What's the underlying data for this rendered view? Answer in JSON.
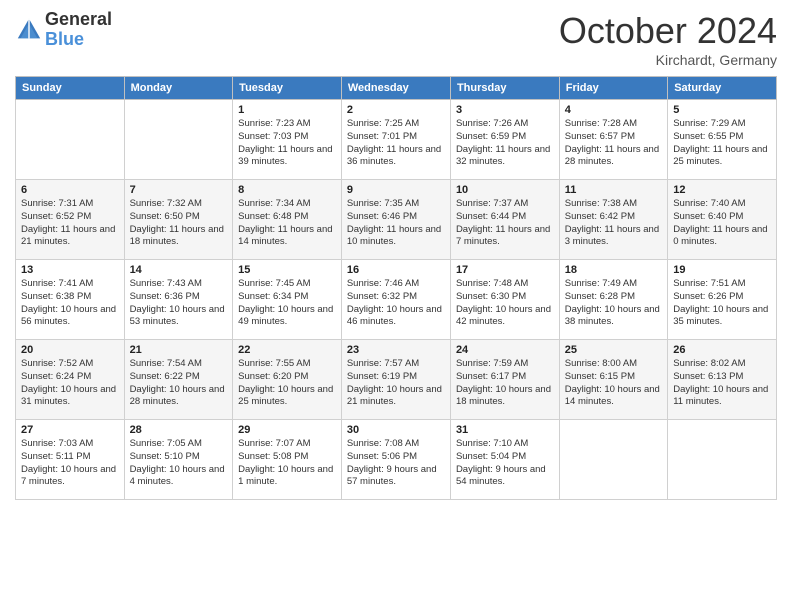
{
  "header": {
    "logo_general": "General",
    "logo_blue": "Blue",
    "month": "October 2024",
    "location": "Kirchardt, Germany"
  },
  "days_of_week": [
    "Sunday",
    "Monday",
    "Tuesday",
    "Wednesday",
    "Thursday",
    "Friday",
    "Saturday"
  ],
  "weeks": [
    [
      {
        "num": "",
        "sunrise": "",
        "sunset": "",
        "daylight": ""
      },
      {
        "num": "",
        "sunrise": "",
        "sunset": "",
        "daylight": ""
      },
      {
        "num": "1",
        "sunrise": "Sunrise: 7:23 AM",
        "sunset": "Sunset: 7:03 PM",
        "daylight": "Daylight: 11 hours and 39 minutes."
      },
      {
        "num": "2",
        "sunrise": "Sunrise: 7:25 AM",
        "sunset": "Sunset: 7:01 PM",
        "daylight": "Daylight: 11 hours and 36 minutes."
      },
      {
        "num": "3",
        "sunrise": "Sunrise: 7:26 AM",
        "sunset": "Sunset: 6:59 PM",
        "daylight": "Daylight: 11 hours and 32 minutes."
      },
      {
        "num": "4",
        "sunrise": "Sunrise: 7:28 AM",
        "sunset": "Sunset: 6:57 PM",
        "daylight": "Daylight: 11 hours and 28 minutes."
      },
      {
        "num": "5",
        "sunrise": "Sunrise: 7:29 AM",
        "sunset": "Sunset: 6:55 PM",
        "daylight": "Daylight: 11 hours and 25 minutes."
      }
    ],
    [
      {
        "num": "6",
        "sunrise": "Sunrise: 7:31 AM",
        "sunset": "Sunset: 6:52 PM",
        "daylight": "Daylight: 11 hours and 21 minutes."
      },
      {
        "num": "7",
        "sunrise": "Sunrise: 7:32 AM",
        "sunset": "Sunset: 6:50 PM",
        "daylight": "Daylight: 11 hours and 18 minutes."
      },
      {
        "num": "8",
        "sunrise": "Sunrise: 7:34 AM",
        "sunset": "Sunset: 6:48 PM",
        "daylight": "Daylight: 11 hours and 14 minutes."
      },
      {
        "num": "9",
        "sunrise": "Sunrise: 7:35 AM",
        "sunset": "Sunset: 6:46 PM",
        "daylight": "Daylight: 11 hours and 10 minutes."
      },
      {
        "num": "10",
        "sunrise": "Sunrise: 7:37 AM",
        "sunset": "Sunset: 6:44 PM",
        "daylight": "Daylight: 11 hours and 7 minutes."
      },
      {
        "num": "11",
        "sunrise": "Sunrise: 7:38 AM",
        "sunset": "Sunset: 6:42 PM",
        "daylight": "Daylight: 11 hours and 3 minutes."
      },
      {
        "num": "12",
        "sunrise": "Sunrise: 7:40 AM",
        "sunset": "Sunset: 6:40 PM",
        "daylight": "Daylight: 11 hours and 0 minutes."
      }
    ],
    [
      {
        "num": "13",
        "sunrise": "Sunrise: 7:41 AM",
        "sunset": "Sunset: 6:38 PM",
        "daylight": "Daylight: 10 hours and 56 minutes."
      },
      {
        "num": "14",
        "sunrise": "Sunrise: 7:43 AM",
        "sunset": "Sunset: 6:36 PM",
        "daylight": "Daylight: 10 hours and 53 minutes."
      },
      {
        "num": "15",
        "sunrise": "Sunrise: 7:45 AM",
        "sunset": "Sunset: 6:34 PM",
        "daylight": "Daylight: 10 hours and 49 minutes."
      },
      {
        "num": "16",
        "sunrise": "Sunrise: 7:46 AM",
        "sunset": "Sunset: 6:32 PM",
        "daylight": "Daylight: 10 hours and 46 minutes."
      },
      {
        "num": "17",
        "sunrise": "Sunrise: 7:48 AM",
        "sunset": "Sunset: 6:30 PM",
        "daylight": "Daylight: 10 hours and 42 minutes."
      },
      {
        "num": "18",
        "sunrise": "Sunrise: 7:49 AM",
        "sunset": "Sunset: 6:28 PM",
        "daylight": "Daylight: 10 hours and 38 minutes."
      },
      {
        "num": "19",
        "sunrise": "Sunrise: 7:51 AM",
        "sunset": "Sunset: 6:26 PM",
        "daylight": "Daylight: 10 hours and 35 minutes."
      }
    ],
    [
      {
        "num": "20",
        "sunrise": "Sunrise: 7:52 AM",
        "sunset": "Sunset: 6:24 PM",
        "daylight": "Daylight: 10 hours and 31 minutes."
      },
      {
        "num": "21",
        "sunrise": "Sunrise: 7:54 AM",
        "sunset": "Sunset: 6:22 PM",
        "daylight": "Daylight: 10 hours and 28 minutes."
      },
      {
        "num": "22",
        "sunrise": "Sunrise: 7:55 AM",
        "sunset": "Sunset: 6:20 PM",
        "daylight": "Daylight: 10 hours and 25 minutes."
      },
      {
        "num": "23",
        "sunrise": "Sunrise: 7:57 AM",
        "sunset": "Sunset: 6:19 PM",
        "daylight": "Daylight: 10 hours and 21 minutes."
      },
      {
        "num": "24",
        "sunrise": "Sunrise: 7:59 AM",
        "sunset": "Sunset: 6:17 PM",
        "daylight": "Daylight: 10 hours and 18 minutes."
      },
      {
        "num": "25",
        "sunrise": "Sunrise: 8:00 AM",
        "sunset": "Sunset: 6:15 PM",
        "daylight": "Daylight: 10 hours and 14 minutes."
      },
      {
        "num": "26",
        "sunrise": "Sunrise: 8:02 AM",
        "sunset": "Sunset: 6:13 PM",
        "daylight": "Daylight: 10 hours and 11 minutes."
      }
    ],
    [
      {
        "num": "27",
        "sunrise": "Sunrise: 7:03 AM",
        "sunset": "Sunset: 5:11 PM",
        "daylight": "Daylight: 10 hours and 7 minutes."
      },
      {
        "num": "28",
        "sunrise": "Sunrise: 7:05 AM",
        "sunset": "Sunset: 5:10 PM",
        "daylight": "Daylight: 10 hours and 4 minutes."
      },
      {
        "num": "29",
        "sunrise": "Sunrise: 7:07 AM",
        "sunset": "Sunset: 5:08 PM",
        "daylight": "Daylight: 10 hours and 1 minute."
      },
      {
        "num": "30",
        "sunrise": "Sunrise: 7:08 AM",
        "sunset": "Sunset: 5:06 PM",
        "daylight": "Daylight: 9 hours and 57 minutes."
      },
      {
        "num": "31",
        "sunrise": "Sunrise: 7:10 AM",
        "sunset": "Sunset: 5:04 PM",
        "daylight": "Daylight: 9 hours and 54 minutes."
      },
      {
        "num": "",
        "sunrise": "",
        "sunset": "",
        "daylight": ""
      },
      {
        "num": "",
        "sunrise": "",
        "sunset": "",
        "daylight": ""
      }
    ]
  ]
}
